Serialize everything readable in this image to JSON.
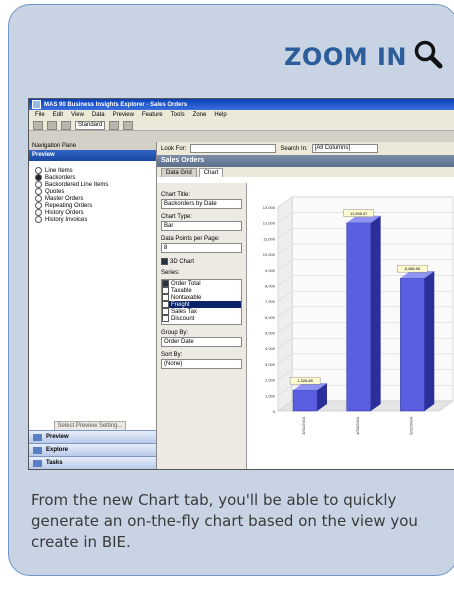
{
  "callout": {
    "zoom_label": "ZOOM IN",
    "caption": "From the new Chart tab, you'll be able to quickly generate an on-the-fly chart based on the view you create in BIE."
  },
  "app": {
    "title": "MAS 90 Business Insights Explorer - Sales Orders",
    "menu": [
      "File",
      "Edit",
      "View",
      "Data",
      "Preview",
      "Feature",
      "Tools",
      "Zone",
      "Help"
    ],
    "toolbar_view_value": "Standard"
  },
  "navigation": {
    "header": "Navigation Pane",
    "preview_header": "Preview",
    "options": [
      "Line Items",
      "Backorders",
      "Backordered Line Items",
      "Quotes",
      "Master Orders",
      "Repeating Orders",
      "History Orders",
      "History Invoices"
    ],
    "selected_index": 1,
    "select_button": "Select Preview Setting...",
    "bottom_tabs": [
      "Preview",
      "Explore",
      "Tasks"
    ]
  },
  "main": {
    "look_for_label": "Look For:",
    "search_in_label": "Search In:",
    "search_in_value": "[All Columns]",
    "panel_title": "Sales Orders",
    "tabs": [
      "Data Grid",
      "Chart"
    ],
    "active_tab": 1
  },
  "chart_options": {
    "chart_title_label": "Chart Title:",
    "chart_title_value": "Backorders by Date",
    "chart_type_label": "Chart Type:",
    "chart_type_value": "Bar",
    "data_points_label": "Data Points per Page:",
    "data_points_value": "8",
    "three_d_label": "3D Chart",
    "series_label": "Series:",
    "series": [
      {
        "label": "Order Total",
        "checked": true,
        "selected": false
      },
      {
        "label": "Taxable",
        "checked": false,
        "selected": false
      },
      {
        "label": "Nontaxable",
        "checked": false,
        "selected": false
      },
      {
        "label": "Freight",
        "checked": false,
        "selected": true
      },
      {
        "label": "Sales Tax",
        "checked": false,
        "selected": false
      },
      {
        "label": "Discount",
        "checked": false,
        "selected": false
      }
    ],
    "group_by_label": "Group By:",
    "group_by_value": "Order Date",
    "sort_by_label": "Sort By:",
    "sort_by_value": "(None)"
  },
  "chart_data": {
    "type": "bar",
    "categories": [
      "3/31/2004",
      "4/30/2004",
      "5/31/2004"
    ],
    "values": [
      1326.85,
      11995.57,
      8466.5
    ],
    "value_labels": [
      "1,326.85",
      "11,995.57",
      "8,466.50"
    ],
    "ylim": [
      0,
      13000
    ],
    "yticks": [
      "0",
      "1,000",
      "2,000",
      "3,000",
      "4,000",
      "5,000",
      "6,000",
      "7,000",
      "8,000",
      "9,000",
      "10,000",
      "11,000",
      "12,000",
      "13,000"
    ],
    "grid": true,
    "bar_color": "#5a5fe0"
  }
}
